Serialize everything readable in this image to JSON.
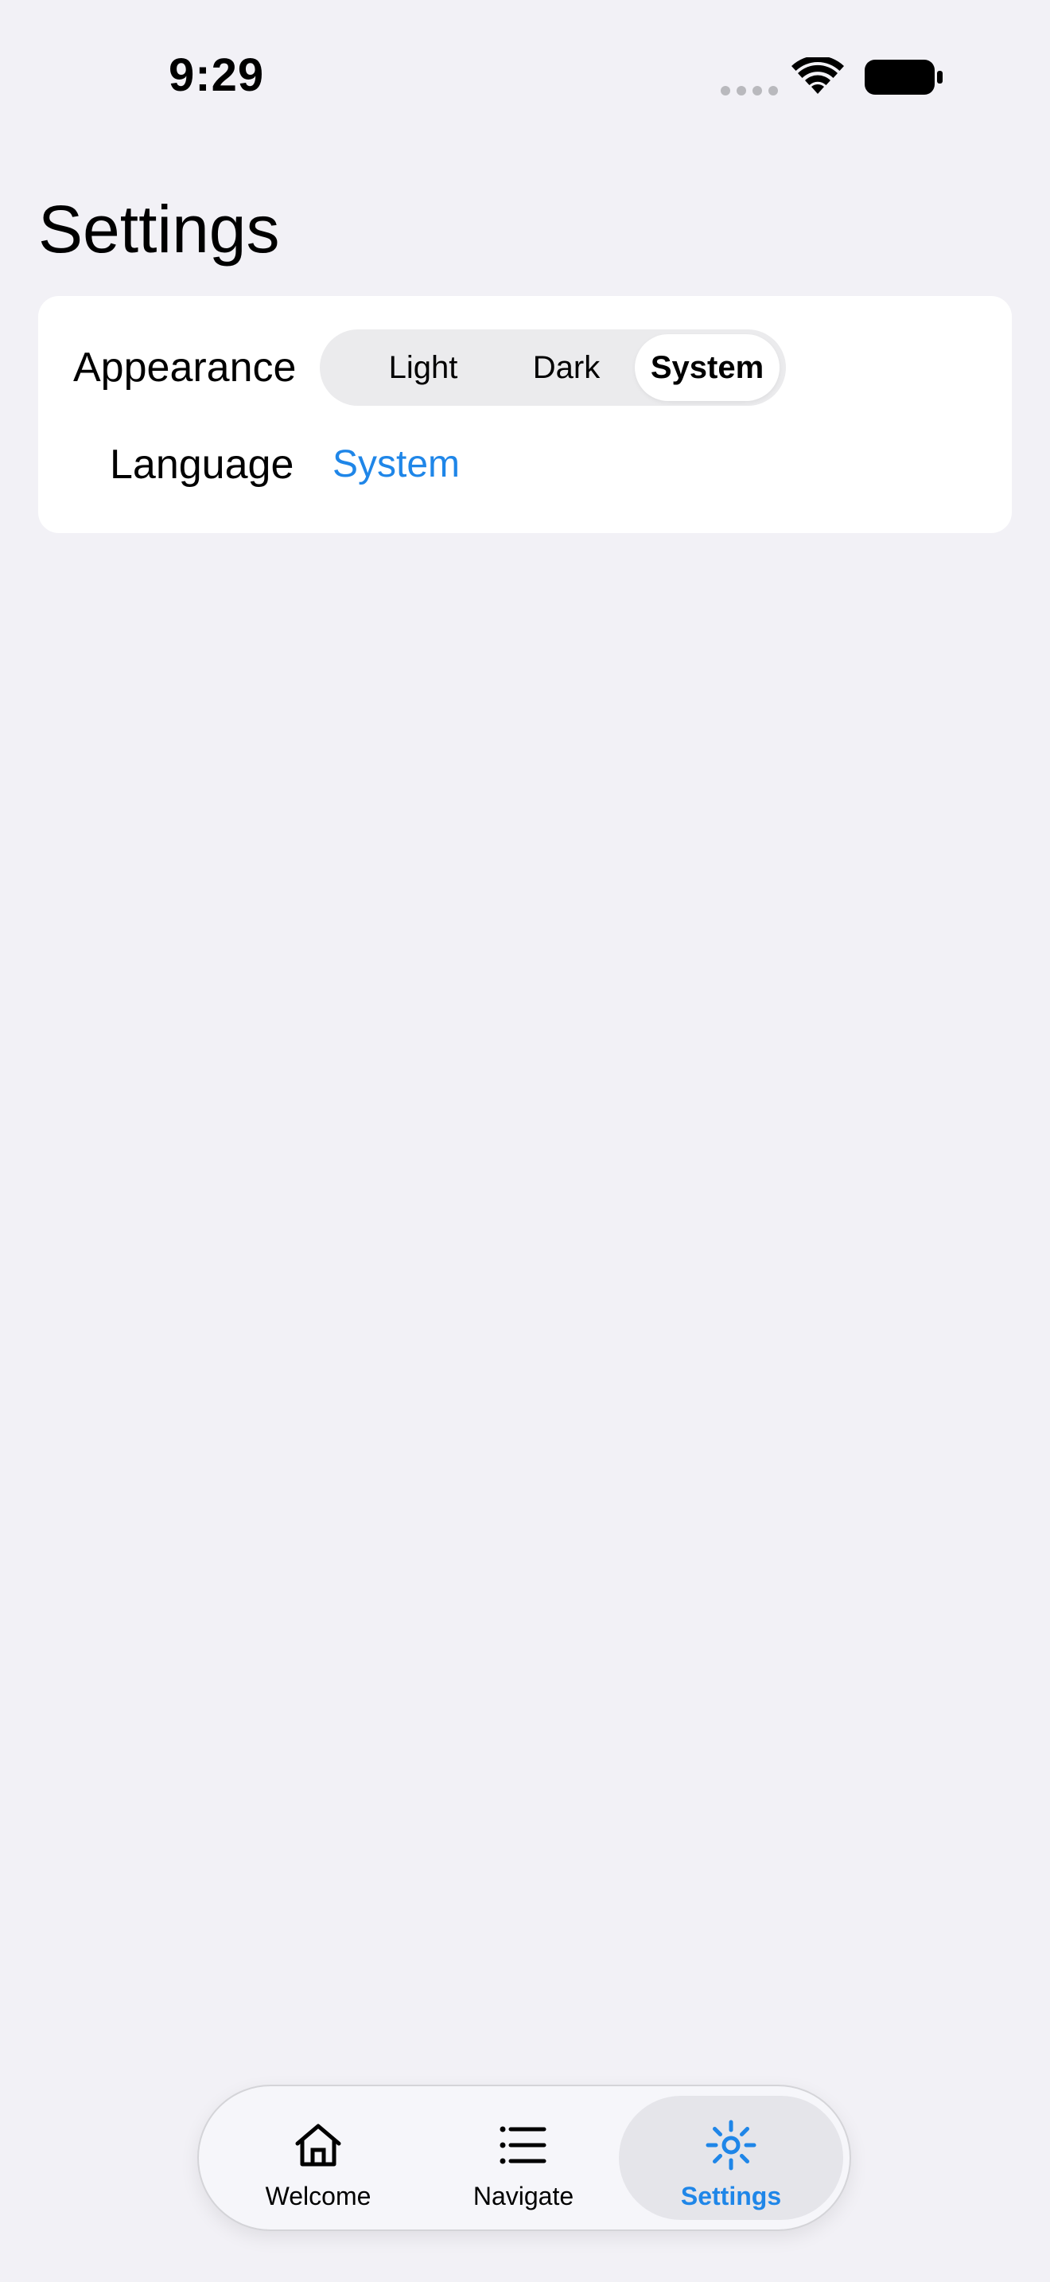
{
  "status_bar": {
    "time": "9:29"
  },
  "page": {
    "title": "Settings"
  },
  "settings": {
    "appearance_label": "Appearance",
    "appearance_options": [
      "Light",
      "Dark",
      "System"
    ],
    "appearance_selected": "System",
    "language_label": "Language",
    "language_value": "System"
  },
  "tab_bar": {
    "tabs": [
      {
        "label": "Welcome",
        "icon": "home-icon"
      },
      {
        "label": "Navigate",
        "icon": "list-icon"
      },
      {
        "label": "Settings",
        "icon": "gear-icon"
      }
    ],
    "selected": "Settings"
  },
  "colors": {
    "background": "#f2f1f6",
    "accent": "#1f86e8",
    "card": "#ffffff"
  }
}
